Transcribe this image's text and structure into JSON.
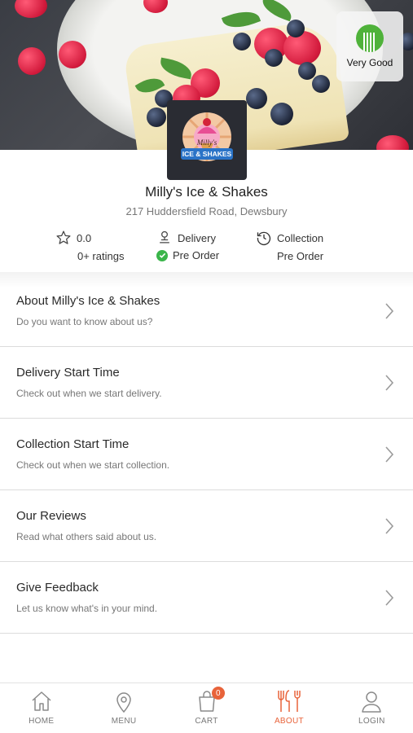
{
  "hero": {
    "rating_badge": {
      "icon": "fork-knife-icon",
      "label": "Very Good",
      "color": "#4fb23a"
    }
  },
  "logo": {
    "alt_text_lines": [
      "Milly's",
      "ICE & SHAKES"
    ]
  },
  "shop": {
    "name": "Milly's Ice & Shakes",
    "address": "217 Huddersfield Road, Dewsbury",
    "rating_value": "0.0",
    "ratings_count": "0+ ratings",
    "delivery_label": "Delivery",
    "delivery_status": "Pre Order",
    "collection_label": "Collection",
    "collection_status": "Pre Order"
  },
  "menu_items": [
    {
      "title": "About Milly's Ice & Shakes",
      "desc": "Do you want to know about us?"
    },
    {
      "title": "Delivery Start Time",
      "desc": "Check out when we start delivery."
    },
    {
      "title": "Collection Start Time",
      "desc": "Check out when we start collection."
    },
    {
      "title": "Our Reviews",
      "desc": "Read what others said about us."
    },
    {
      "title": "Give Feedback",
      "desc": "Let us know what's in your mind."
    }
  ],
  "tabbar": {
    "accent": "#e8633a",
    "tabs": [
      {
        "label": "HOME",
        "icon": "home-icon"
      },
      {
        "label": "MENU",
        "icon": "location-pin-icon"
      },
      {
        "label": "CART",
        "icon": "shopping-bag-icon",
        "badge": "0"
      },
      {
        "label": "ABOUT",
        "icon": "fork-knife-icon",
        "active": true
      },
      {
        "label": "LOGIN",
        "icon": "user-icon"
      }
    ]
  }
}
